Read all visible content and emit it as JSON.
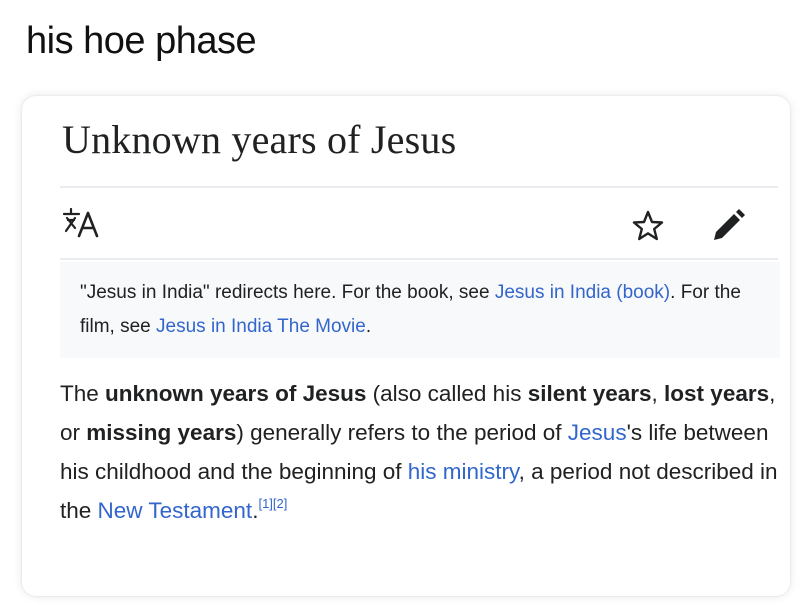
{
  "caption": "his hoe phase",
  "article": {
    "title": "Unknown years of Jesus",
    "toolbar": {
      "language_icon": "translate-icon",
      "watch_icon": "star-outline-icon",
      "edit_icon": "pencil-icon"
    },
    "hatnote": {
      "t1": "\"Jesus in India\" redirects here. For the book, see ",
      "link1": "Jesus in India (book)",
      "t2": ". For the film, see ",
      "link2": "Jesus in India The Movie",
      "t3": "."
    },
    "paragraph": {
      "p1": "The ",
      "b1": "unknown years of Jesus",
      "p2": " (also called his ",
      "b2": "silent years",
      "p3": ", ",
      "b3": "lost years",
      "p4": ", or ",
      "b4": "missing years",
      "p5": ") generally refers to the period of ",
      "link1": "Jesus",
      "p6": "'s life between his childhood and the beginning of ",
      "link2": "his ministry",
      "p7": ", a period not described in the ",
      "link3": "New Testament",
      "p8": ".",
      "ref1": "[1]",
      "ref2": "[2]"
    }
  },
  "colors": {
    "link": "#3366cc",
    "text": "#202122",
    "hatnote_bg": "#f8f9fa",
    "rule": "#eaecf0"
  }
}
